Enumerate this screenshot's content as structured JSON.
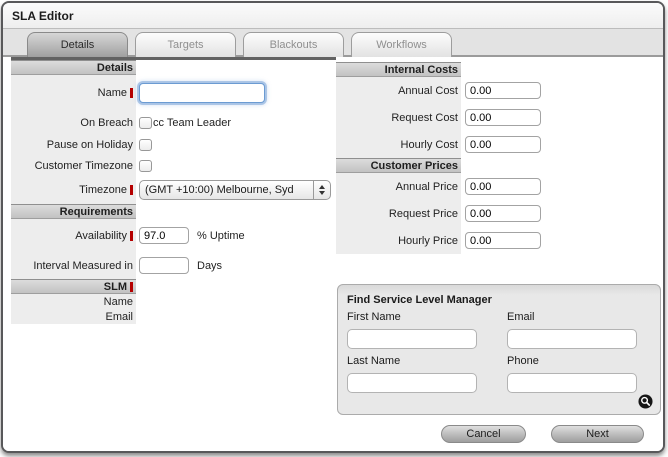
{
  "window": {
    "title": "SLA Editor"
  },
  "tabs": [
    {
      "label": "Details",
      "active": true
    },
    {
      "label": "Targets",
      "active": false
    },
    {
      "label": "Blackouts",
      "active": false
    },
    {
      "label": "Workflows",
      "active": false
    }
  ],
  "details": {
    "header": "Details",
    "name": {
      "label": "Name",
      "required": true,
      "value": ""
    },
    "on_breach": {
      "label": "On Breach",
      "checkbox_label": "cc Team Leader",
      "checked": false
    },
    "pause_on_holiday": {
      "label": "Pause on Holiday",
      "checked": false
    },
    "customer_timezone": {
      "label": "Customer Timezone",
      "checked": false
    },
    "timezone": {
      "label": "Timezone",
      "required": true,
      "selected_option": "(GMT +10:00) Melbourne, Syd"
    }
  },
  "requirements": {
    "header": "Requirements",
    "availability": {
      "label": "Availability",
      "required": true,
      "value": "97.0",
      "suffix": "% Uptime"
    },
    "interval": {
      "label": "Interval Measured in",
      "value": "",
      "suffix": "Days"
    }
  },
  "slm": {
    "header": "SLM",
    "required": true,
    "name_label": "Name",
    "email_label": "Email"
  },
  "internal_costs": {
    "header": "Internal Costs",
    "rows": [
      {
        "label": "Annual Cost",
        "value": "0.00"
      },
      {
        "label": "Request Cost",
        "value": "0.00"
      },
      {
        "label": "Hourly Cost",
        "value": "0.00"
      }
    ]
  },
  "customer_prices": {
    "header": "Customer Prices",
    "rows": [
      {
        "label": "Annual Price",
        "value": "0.00"
      },
      {
        "label": "Request Price",
        "value": "0.00"
      },
      {
        "label": "Hourly Price",
        "value": "0.00"
      }
    ]
  },
  "find_slm": {
    "title": "Find Service Level Manager",
    "first_name": {
      "label": "First Name",
      "value": ""
    },
    "email": {
      "label": "Email",
      "value": ""
    },
    "last_name": {
      "label": "Last Name",
      "value": ""
    },
    "phone": {
      "label": "Phone",
      "value": ""
    },
    "search_icon": "magnifier-icon"
  },
  "footer": {
    "cancel_label": "Cancel",
    "next_label": "Next"
  },
  "colors": {
    "window_border": "#58585a",
    "label_column_bg": "#ededed",
    "section_bar_top": "#dcdcdc",
    "section_bar_bottom": "#c2c2c2",
    "required_marker": "#b50000",
    "focus_ring_blue": "#7da6d9",
    "tab_active_text": "#2b2b2b",
    "tab_inactive_text": "#8f8f8f",
    "find_box_bg": "#e8e8e8",
    "button_gradient_top": "#dfdfdf",
    "button_gradient_bottom": "#9e9e9e"
  }
}
